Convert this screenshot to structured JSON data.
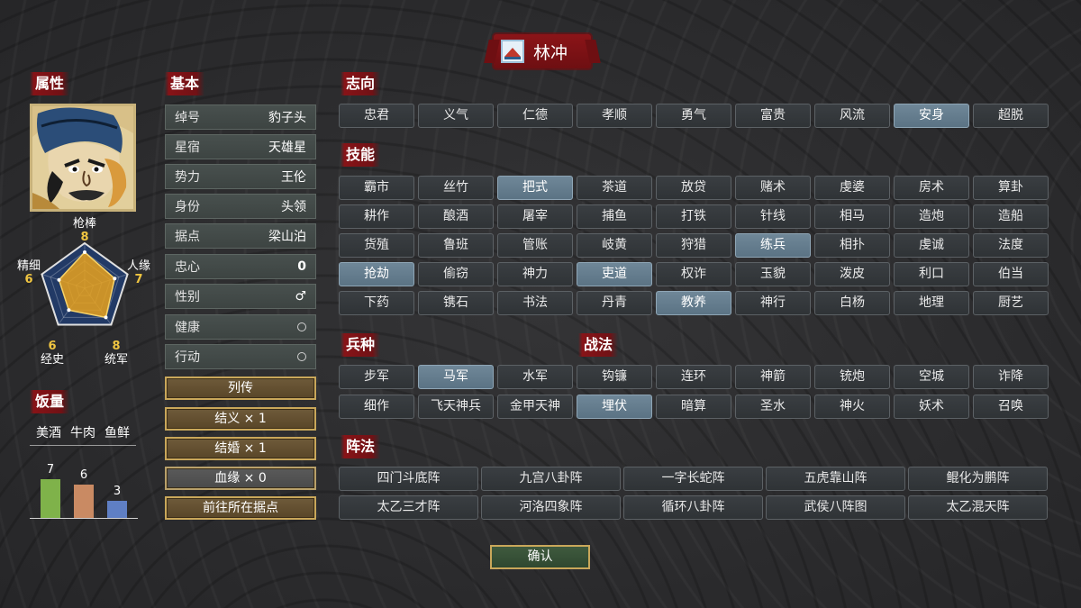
{
  "character": {
    "name": "林冲"
  },
  "sections": {
    "attributes": "属性",
    "basic": "基本",
    "ambition": "志向",
    "skills": "技能",
    "troops": "兵种",
    "tactics": "战法",
    "formations": "阵法",
    "food": "饭量"
  },
  "radar": {
    "stats": [
      {
        "label": "枪棒",
        "value": "8",
        "num": 8
      },
      {
        "label": "人缘",
        "value": "7",
        "num": 7
      },
      {
        "label": "统军",
        "value": "8",
        "num": 8
      },
      {
        "label": "经史",
        "value": "6",
        "num": 6
      },
      {
        "label": "精细",
        "value": "6",
        "num": 6
      }
    ],
    "max": 10
  },
  "food": {
    "labels": [
      "美酒",
      "牛肉",
      "鱼鲜"
    ],
    "values": [
      7,
      6,
      3
    ],
    "value_labels": [
      "7",
      "6",
      "3"
    ],
    "colors": [
      "#7fb24a",
      "#c98a63",
      "#5f7fc4"
    ]
  },
  "basic": {
    "rows": [
      {
        "key": "绰号",
        "value": "豹子头"
      },
      {
        "key": "星宿",
        "value": "天雄星"
      },
      {
        "key": "势力",
        "value": "王伦"
      },
      {
        "key": "身份",
        "value": "头领"
      },
      {
        "key": "据点",
        "value": "梁山泊"
      },
      {
        "key": "忠心",
        "value": "0"
      },
      {
        "key": "性别",
        "value": "♂"
      },
      {
        "key": "健康",
        "value": ""
      },
      {
        "key": "行动",
        "value": ""
      }
    ],
    "buttons": [
      "列传",
      "结义 × 1",
      "结婚 × 1",
      "血缘 × 0",
      "前往所在据点"
    ]
  },
  "ambition": {
    "items": [
      "忠君",
      "义气",
      "仁德",
      "孝顺",
      "勇气",
      "富贵",
      "风流",
      "安身",
      "超脱"
    ],
    "selected": [
      "安身"
    ]
  },
  "skills": {
    "rows": [
      [
        "霸市",
        "丝竹",
        "把式",
        "茶道",
        "放贷",
        "赌术",
        "虔婆",
        "房术",
        "算卦"
      ],
      [
        "耕作",
        "酿酒",
        "屠宰",
        "捕鱼",
        "打铁",
        "针线",
        "相马",
        "造炮",
        "造船"
      ],
      [
        "货殖",
        "鲁班",
        "管账",
        "岐黄",
        "狩猎",
        "练兵",
        "相扑",
        "虔诚",
        "法度"
      ],
      [
        "抢劫",
        "偷窃",
        "神力",
        "吏道",
        "权诈",
        "玉貌",
        "泼皮",
        "利口",
        "伯当"
      ],
      [
        "下药",
        "镌石",
        "书法",
        "丹青",
        "教养",
        "神行",
        "白杨",
        "地理",
        "厨艺"
      ]
    ],
    "selected": [
      "把式",
      "练兵",
      "抢劫",
      "吏道",
      "教养"
    ]
  },
  "troops": {
    "items": [
      "步军",
      "马军",
      "水军",
      "细作",
      "飞天神兵",
      "金甲天神"
    ],
    "selected": [
      "马军"
    ]
  },
  "tactics": {
    "rows": [
      [
        "钩镰",
        "连环",
        "神箭",
        "铳炮",
        "空城",
        "诈降"
      ],
      [
        "埋伏",
        "暗算",
        "圣水",
        "神火",
        "妖术",
        "召唤"
      ]
    ],
    "selected": [
      "埋伏"
    ]
  },
  "formations": {
    "rows": [
      [
        "四门斗底阵",
        "九宫八卦阵",
        "一字长蛇阵",
        "五虎靠山阵",
        "鲲化为鹏阵"
      ],
      [
        "太乙三才阵",
        "河洛四象阵",
        "循环八卦阵",
        "武侯八阵图",
        "太乙混天阵"
      ]
    ]
  },
  "confirm_label": "确认",
  "colors": {
    "selected": "#6f8798",
    "radar_fill": "#e8a21e",
    "accent_red": "#8b1418",
    "gold_border": "#c9a75a"
  }
}
